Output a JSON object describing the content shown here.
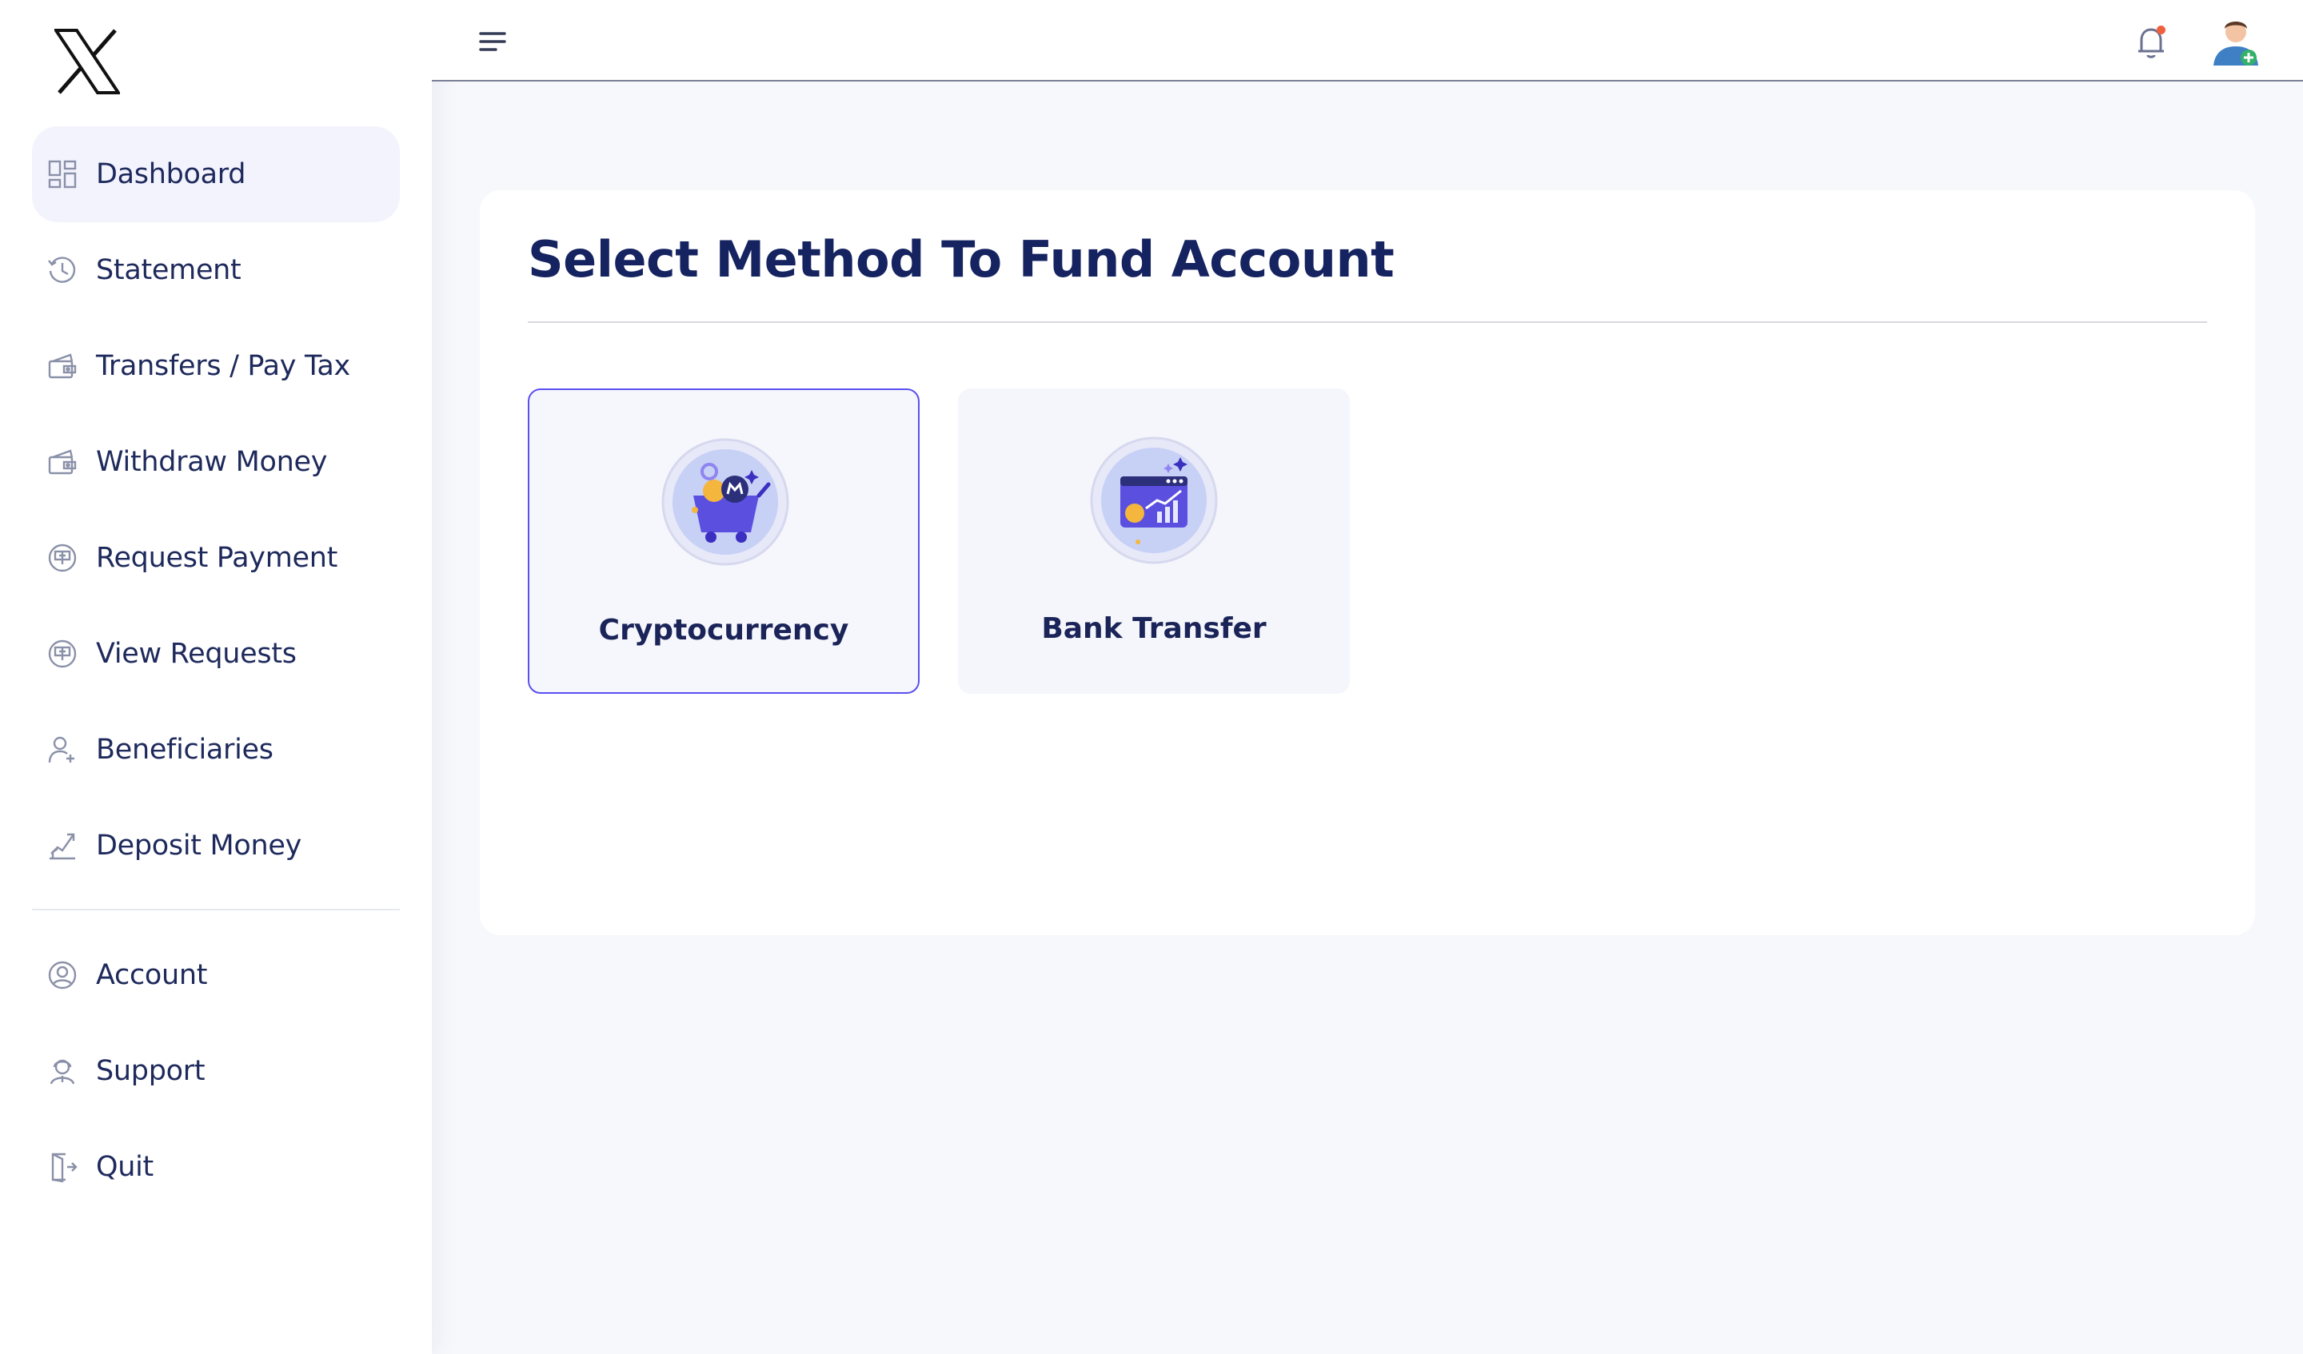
{
  "sidebar": {
    "logo_icon": "x-logo-icon",
    "items": [
      {
        "label": "Dashboard",
        "icon": "dashboard-icon",
        "active": true
      },
      {
        "label": "Statement",
        "icon": "history-icon"
      },
      {
        "label": "Transfers / Pay Tax",
        "icon": "wallet-transfer-icon"
      },
      {
        "label": "Withdraw Money",
        "icon": "wallet-withdraw-icon"
      },
      {
        "label": "Request Payment",
        "icon": "payment-request-icon"
      },
      {
        "label": "View Requests",
        "icon": "view-requests-icon"
      },
      {
        "label": "Beneficiaries",
        "icon": "user-add-icon"
      },
      {
        "label": "Deposit Money",
        "icon": "deposit-icon"
      }
    ],
    "secondary": [
      {
        "label": "Account",
        "icon": "account-icon"
      },
      {
        "label": "Support",
        "icon": "support-icon"
      },
      {
        "label": "Quit",
        "icon": "logout-icon"
      }
    ]
  },
  "topbar": {
    "menu_icon": "menu-icon",
    "bell_icon": "bell-icon",
    "avatar_icon": "avatar-icon"
  },
  "main": {
    "title": "Select Method To Fund Account",
    "methods": [
      {
        "label": "Cryptocurrency",
        "icon": "crypto-cart-icon",
        "selected": true
      },
      {
        "label": "Bank Transfer",
        "icon": "bank-dashboard-icon",
        "selected": false
      }
    ]
  },
  "colors": {
    "accent": "#5a4ff0",
    "title": "#152360",
    "active_nav": "#f3f3fe",
    "notification": "#f0603c"
  }
}
